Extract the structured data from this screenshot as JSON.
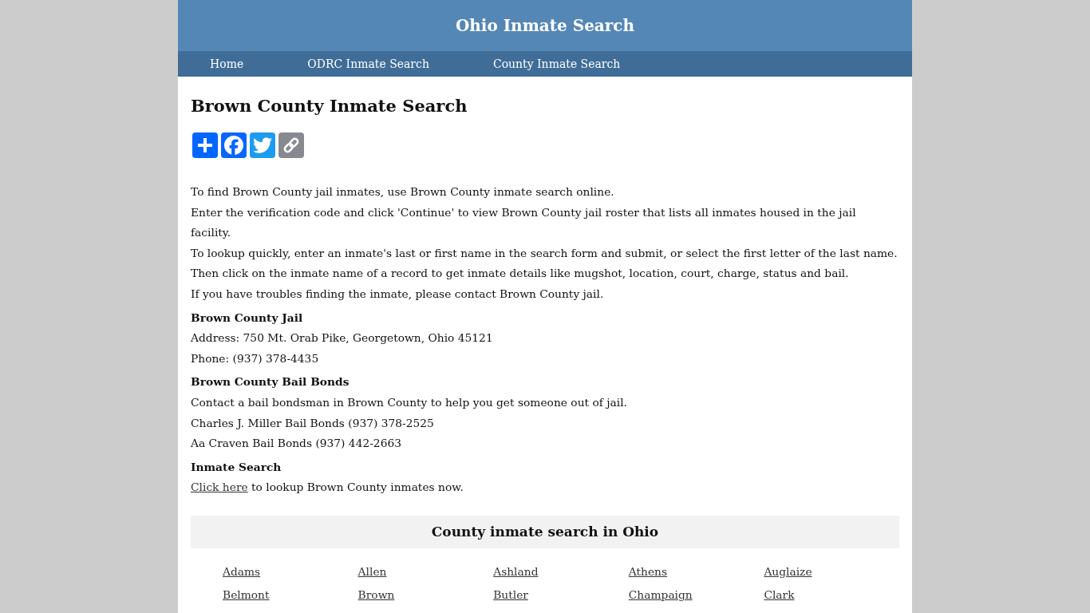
{
  "header": {
    "title": "Ohio Inmate Search"
  },
  "nav": [
    {
      "label": "Home"
    },
    {
      "label": "ODRC Inmate Search"
    },
    {
      "label": "County Inmate Search"
    }
  ],
  "page_title": "Brown County Inmate Search",
  "share_buttons": [
    {
      "kind": "share"
    },
    {
      "kind": "facebook"
    },
    {
      "kind": "twitter"
    },
    {
      "kind": "copy_link"
    }
  ],
  "intro": [
    "To find Brown County jail inmates, use Brown County inmate search online.",
    "Enter the verification code and click 'Continue' to view Brown County jail roster that lists all inmates housed in the jail facility.",
    "To lookup quickly, enter an inmate's last or first name in the search form and submit, or select the first letter of the last name.",
    "Then click on the inmate name of a record to get inmate details like mugshot, location, court, charge, status and bail.",
    "If you have troubles finding the inmate, please contact Brown County jail."
  ],
  "sections": [
    {
      "heading": "Brown County Jail",
      "lines": [
        {
          "text": "Address: 750 Mt. Orab Pike, Georgetown, Ohio 45121"
        },
        {
          "text": "Phone: (937) 378-4435"
        }
      ]
    },
    {
      "heading": "Brown County Bail Bonds",
      "lines": [
        {
          "text": "Contact a bail bondsman in Brown County to help you get someone out of jail."
        },
        {
          "text": "Charles J. Miller Bail Bonds (937) 378-2525"
        },
        {
          "text": "Aa Craven Bail Bonds (937) 442-2663"
        }
      ]
    },
    {
      "heading": "Inmate Search",
      "lines": [
        {
          "link": "Click here",
          "text": " to lookup Brown County inmates now."
        }
      ]
    }
  ],
  "county_list": {
    "title": "County inmate search in Ohio",
    "counties": [
      "Adams",
      "Allen",
      "Ashland",
      "Athens",
      "Auglaize",
      "Belmont",
      "Brown",
      "Butler",
      "Champaign",
      "Clark"
    ]
  }
}
